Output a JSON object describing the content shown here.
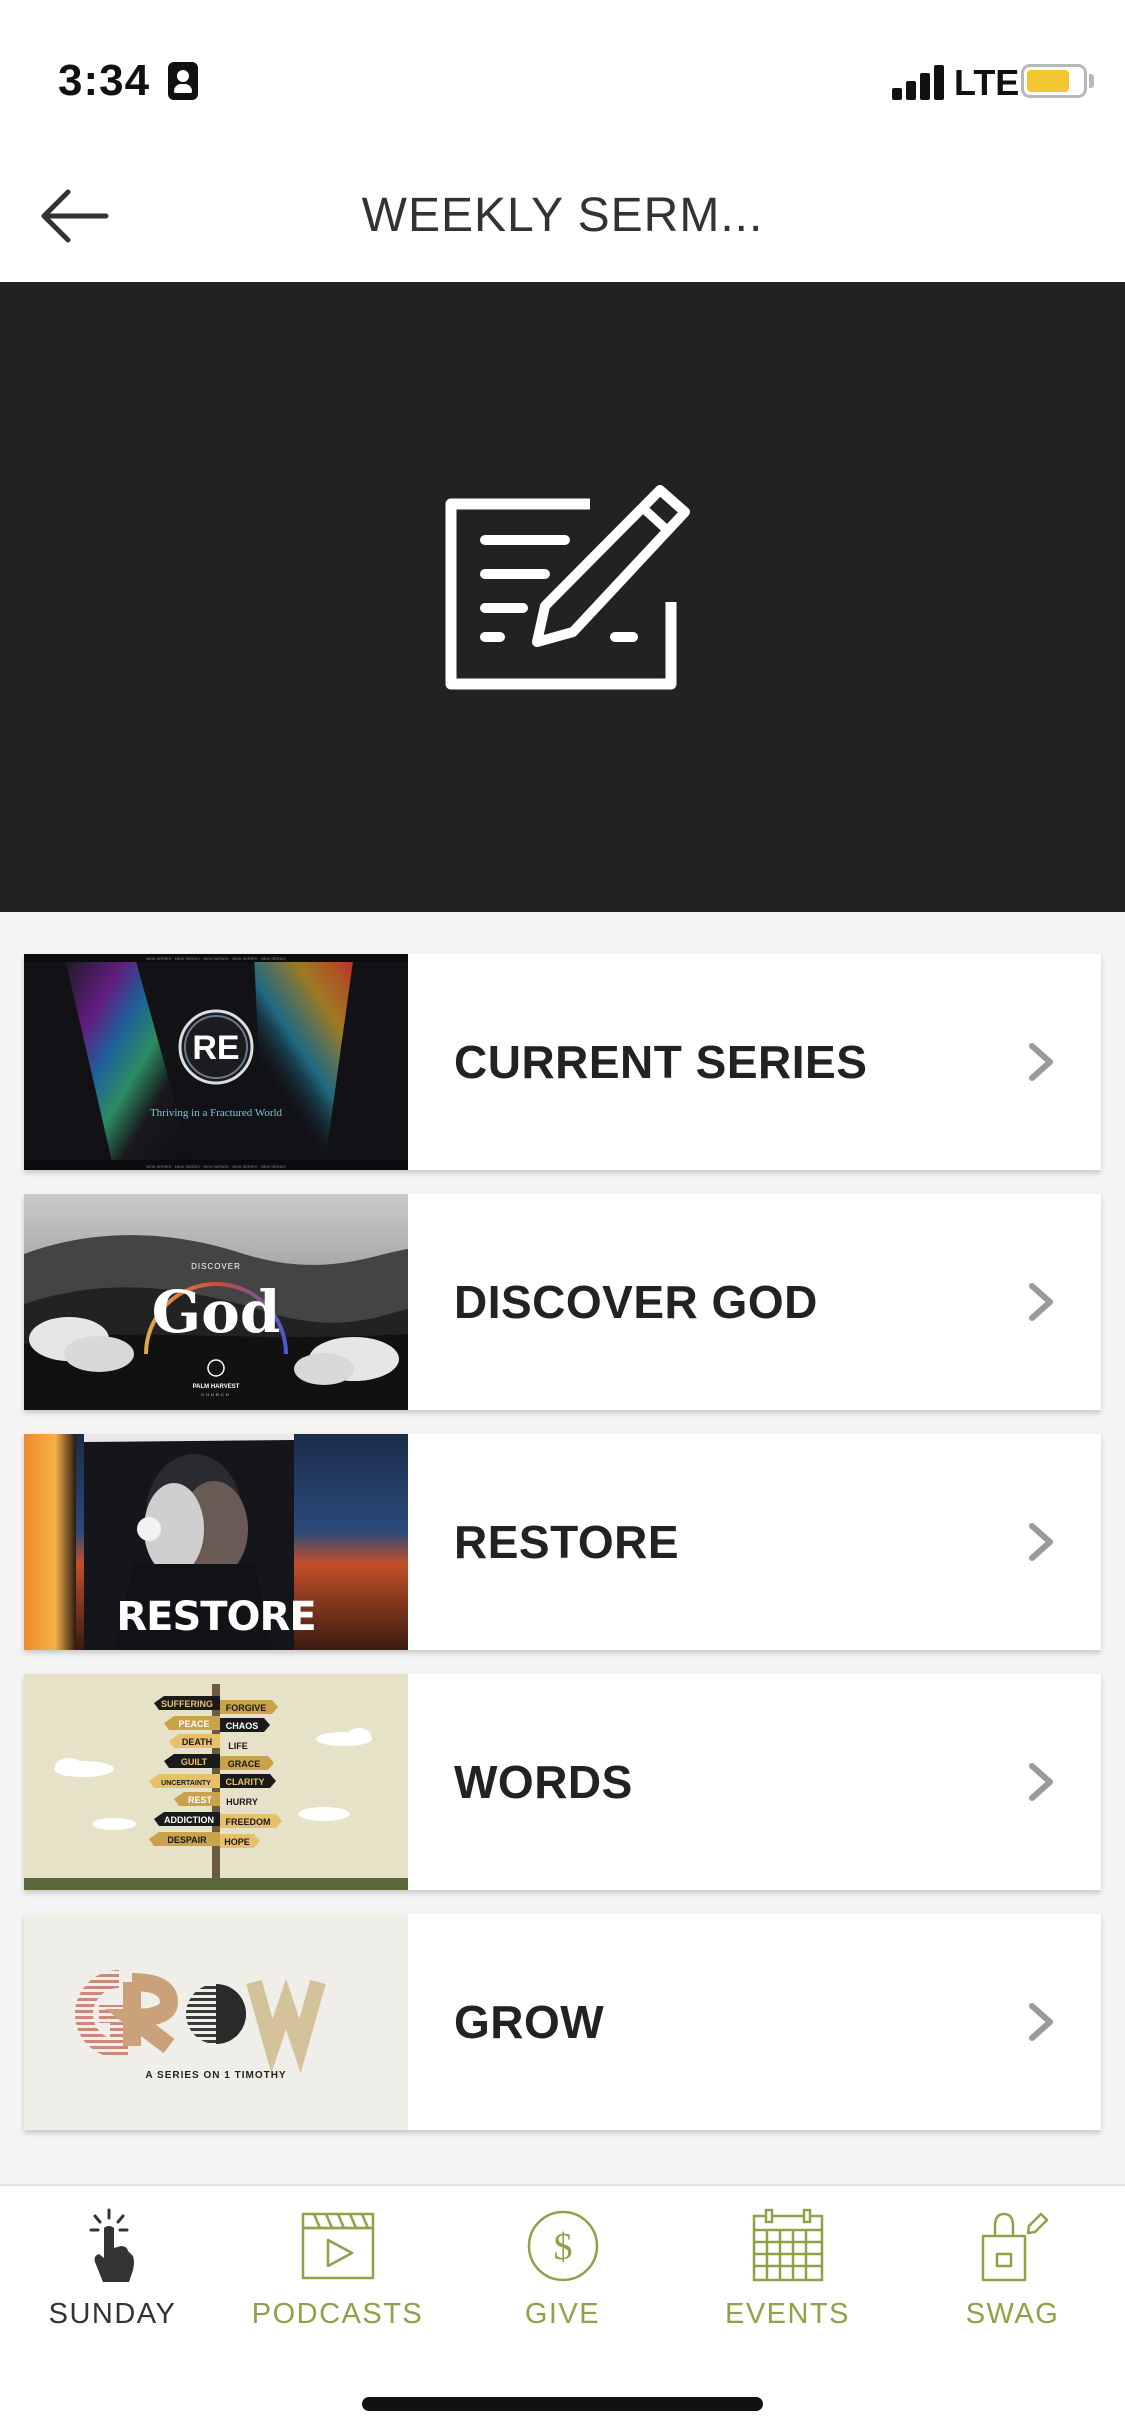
{
  "status_bar": {
    "time": "3:34",
    "network": "LTE",
    "battery_color": "#f4c631"
  },
  "nav": {
    "title": "WEEKLY SERM...",
    "back_icon": "arrow-left-icon"
  },
  "hero": {
    "icon": "document-edit-icon",
    "background": "#232123"
  },
  "list": {
    "items": [
      {
        "label": "CURRENT SERIES",
        "thumbnail": {
          "badge": "RE",
          "caption": "Thriving in a Fractured World",
          "border_text": "NEW SERIES · NEW SERIES · NEW SERIES · NEW SERIES · NEW SERIES"
        }
      },
      {
        "label": "DISCOVER GOD",
        "thumbnail": {
          "small": "DISCOVER",
          "big": "God",
          "org": "PALM HARVEST",
          "org_sub": "CHURCH"
        }
      },
      {
        "label": "RESTORE",
        "thumbnail": {
          "title": "RESTORE"
        }
      },
      {
        "label": "WORDS",
        "thumbnail": {
          "signs": [
            "SUFFERING",
            "FORGIVE",
            "PEACE",
            "CHAOS",
            "DEATH",
            "LIFE",
            "GUILT",
            "GRACE",
            "UNCERTAINTY",
            "CLARITY",
            "REST",
            "HURRY",
            "ADDICTION",
            "FREEDOM",
            "DESPAIR",
            "HOPE"
          ]
        }
      },
      {
        "label": "GROW",
        "thumbnail": {
          "title": "GROW",
          "subtitle": "A SERIES ON 1 TIMOTHY"
        }
      }
    ]
  },
  "tab_bar": {
    "active_color": "#333333",
    "inactive_color": "#8ea24a",
    "tabs": [
      {
        "label": "SUNDAY",
        "icon": "tap-hand-icon",
        "active": true
      },
      {
        "label": "PODCASTS",
        "icon": "clapperboard-icon",
        "active": false
      },
      {
        "label": "GIVE",
        "icon": "dollar-circle-icon",
        "active": false
      },
      {
        "label": "EVENTS",
        "icon": "calendar-icon",
        "active": false
      },
      {
        "label": "SWAG",
        "icon": "shopping-bag-icon",
        "active": false
      }
    ]
  }
}
